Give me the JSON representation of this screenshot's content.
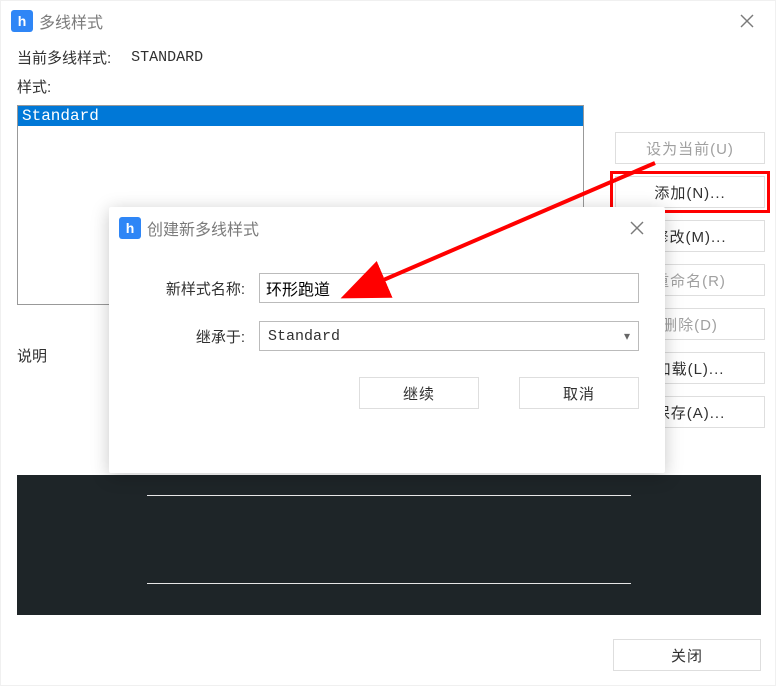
{
  "main": {
    "title": "多线样式",
    "current_label": "当前多线样式:",
    "current_value": "STANDARD",
    "styles_label": "样式:",
    "style_items": [
      "Standard"
    ],
    "desc_label": "说明"
  },
  "buttons": {
    "set_current": "设为当前(U)",
    "add": "添加(N)...",
    "modify": "修改(M)...",
    "rename": "重命名(R)",
    "delete": "删除(D)",
    "load": "加载(L)...",
    "save": "保存(A)...",
    "close": "关闭"
  },
  "subdialog": {
    "title": "创建新多线样式",
    "name_label": "新样式名称:",
    "name_value": "环形跑道",
    "inherit_label": "继承于:",
    "inherit_value": "Standard",
    "continue": "继续",
    "cancel": "取消"
  }
}
